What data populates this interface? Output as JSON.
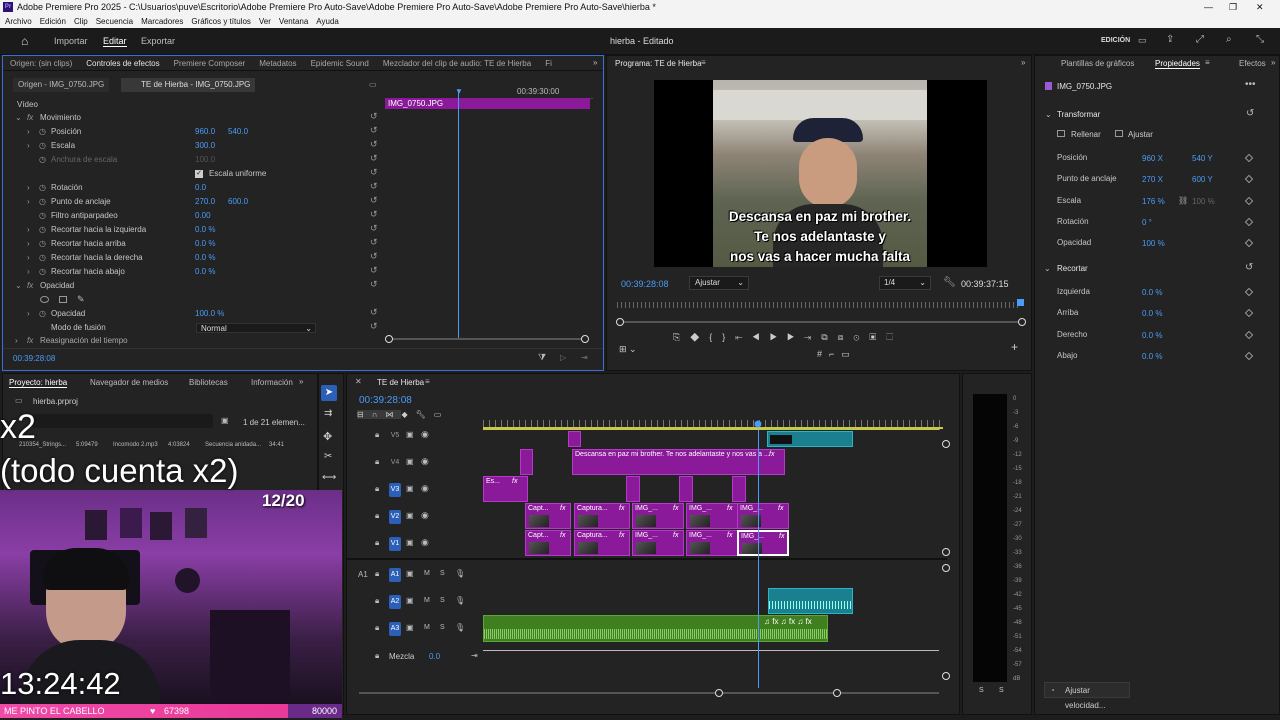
{
  "window": {
    "title": "Adobe Premiere Pro 2025 - C:\\Usuarios\\puve\\Escritorio\\Adobe Premiere Pro Auto-Save\\Adobe Premiere Pro Auto-Save\\Adobe Premiere Pro Auto-Save\\hierba *"
  },
  "menu": [
    "Archivo",
    "Edición",
    "Clip",
    "Secuencia",
    "Marcadores",
    "Gráficos y títulos",
    "Ver",
    "Ventana",
    "Ayuda"
  ],
  "header": {
    "tabs": [
      "Importar",
      "Editar",
      "Exportar"
    ],
    "active": "Editar",
    "project_title": "hierba - Editado",
    "workspace": "EDICIÓN"
  },
  "source_panel": {
    "tabs": [
      "Origen: (sin clips)",
      "Controles de efectos",
      "Premiere Composer",
      "Metadatos",
      "Epidemic Sound",
      "Mezclador del clip de audio: TE de Hierba",
      "Fi"
    ],
    "active_tab": "Controles de efectos",
    "subtabs": [
      "Origen - IMG_0750.JPG",
      "TE de Hierba - IMG_0750.JPG"
    ],
    "section_video": "Vídeo",
    "timecode_ruler": "00:39:30:00",
    "clip_name": "IMG_0750.JPG",
    "motion": "Movimiento",
    "params": [
      {
        "name": "Posición",
        "v1": "960.0",
        "v2": "540.0"
      },
      {
        "name": "Escala",
        "v1": "300.0",
        "v2": ""
      },
      {
        "name": "Anchura de escala",
        "v1": "100.0",
        "v2": ""
      },
      {
        "name": "Escala uniforme",
        "v1": "",
        "v2": ""
      },
      {
        "name": "Rotación",
        "v1": "0.0",
        "v2": ""
      },
      {
        "name": "Punto de anclaje",
        "v1": "270.0",
        "v2": "600.0"
      },
      {
        "name": "Filtro antiparpadeo",
        "v1": "0.00",
        "v2": ""
      },
      {
        "name": "Recortar hacia la izquierda",
        "v1": "0.0 %",
        "v2": ""
      },
      {
        "name": "Recortar hacia arriba",
        "v1": "0.0 %",
        "v2": ""
      },
      {
        "name": "Recortar hacia la derecha",
        "v1": "0.0 %",
        "v2": ""
      },
      {
        "name": "Recortar hacia abajo",
        "v1": "0.0 %",
        "v2": ""
      }
    ],
    "opacity_section": "Opacidad",
    "opacity_label": "Opacidad",
    "opacity_value": "100.0 %",
    "blend_label": "Modo de fusión",
    "blend_value": "Normal",
    "remap": "Reasignación del tiempo",
    "timecode": "00:39:28:08"
  },
  "program": {
    "title": "Programa: TE de Hierba",
    "subtitle_lines": [
      "Descansa en paz mi brother.",
      "Te nos adelantaste y",
      "nos vas a hacer mucha falta"
    ],
    "timecode": "00:39:28:08",
    "fit": "Ajustar",
    "quality": "1/4",
    "duration": "00:39:37:15"
  },
  "properties": {
    "tabs": [
      "Plantillas de gráficos",
      "Propiedades",
      "Efectos"
    ],
    "active_tab": "Propiedades",
    "clip": "IMG_0750.JPG",
    "transform": "Transformar",
    "fill": "Rellenar",
    "fit": "Ajustar",
    "rows": [
      {
        "name": "Posición",
        "a": "960",
        "au": "X",
        "b": "540",
        "bu": "Y"
      },
      {
        "name": "Punto de anclaje",
        "a": "270",
        "au": "X",
        "b": "600",
        "bu": "Y"
      },
      {
        "name": "Escala",
        "a": "176",
        "au": "%",
        "b": "100",
        "bu": "%"
      },
      {
        "name": "Rotación",
        "a": "0",
        "au": "°",
        "b": "",
        "bu": ""
      },
      {
        "name": "Opacidad",
        "a": "100",
        "au": "%",
        "b": "",
        "bu": ""
      }
    ],
    "crop": "Recortar",
    "crop_rows": [
      {
        "name": "Izquierda",
        "a": "0.0",
        "au": "%"
      },
      {
        "name": "Arriba",
        "a": "0.0",
        "au": "%"
      },
      {
        "name": "Derecho",
        "a": "0.0",
        "au": "%"
      },
      {
        "name": "Abajo",
        "a": "0.0",
        "au": "%"
      }
    ],
    "speed_button": "Ajustar velocidad..."
  },
  "project": {
    "tabs": [
      "Proyecto: hierba",
      "Navegador de medios",
      "Bibliotecas",
      "Información"
    ],
    "file": "hierba.prproj",
    "count": "1 de 21 elemen...",
    "items": [
      "210354_Strings...",
      "5:09479",
      "Incomodo 2.mp3",
      "4:03824",
      "Secuencia anidada...",
      "34:41"
    ]
  },
  "timeline": {
    "title": "TE de Hierba",
    "timecode": "00:39:28:08",
    "tracks_video": [
      "V5",
      "V4",
      "V3",
      "V2",
      "V1"
    ],
    "tracks_audio": [
      "A1",
      "A2",
      "A3"
    ],
    "mix_label": "Mezcla",
    "mix_value": "0.0",
    "v4_clip": "Descansa en paz mi brother. Te nos adelantaste y nos vas a ...",
    "v3_clip": "Es...",
    "v2_clips": [
      "Capt...",
      "Captura...",
      "IMG_...",
      "IMG_...",
      "IMG_..."
    ],
    "v1_clips": [
      "Capt...",
      "Captura...",
      "IMG_...",
      "IMG_...",
      "IMG_..."
    ],
    "fx": "fx"
  },
  "meter": {
    "ticks": [
      "0",
      "-3",
      "-6",
      "-9",
      "-12",
      "-15",
      "-18",
      "-21",
      "-24",
      "-27",
      "-30",
      "-33",
      "-36",
      "-39",
      "-42",
      "-45",
      "-48",
      "-51",
      "-54",
      "-57",
      "dB"
    ],
    "channels": [
      "S",
      "S"
    ]
  },
  "overlay": {
    "multiplier": "x2",
    "caption": "(todo cuenta x2)",
    "counter": "12/20",
    "clock": "13:24:42",
    "bottom_label": "ME PINTO EL CABELLO",
    "likes": "67398",
    "goal": "80000"
  }
}
